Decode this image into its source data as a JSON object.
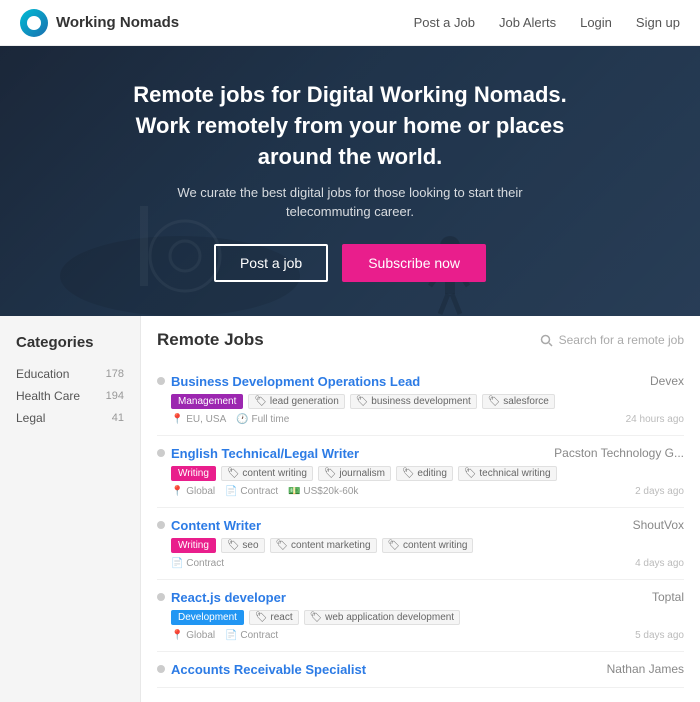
{
  "navbar": {
    "brand": "Working Nomads",
    "links": [
      "Post a Job",
      "Job Alerts",
      "Login",
      "Sign up"
    ]
  },
  "hero": {
    "title": "Remote jobs for Digital Working Nomads. Work remotely from your home or places around the world.",
    "subtitle": "We curate the best digital jobs for those looking to start their telecommuting career.",
    "button_post": "Post a job",
    "button_subscribe": "Subscribe now"
  },
  "sidebar": {
    "title": "Categories",
    "items": [
      {
        "label": "Education",
        "count": "178"
      },
      {
        "label": "Health Care",
        "count": "194"
      },
      {
        "label": "Legal",
        "count": "41"
      }
    ]
  },
  "jobs": {
    "section_title": "Remote Jobs",
    "search_placeholder": "Search for a remote job",
    "items": [
      {
        "title": "Business Development Operations Lead",
        "company": "Devex",
        "category": "Management",
        "category_class": "tag-management",
        "tags": [
          "lead generation",
          "business development",
          "salesforce"
        ],
        "meta_left": [
          "EU, USA",
          "Full time"
        ],
        "time": "24 hours ago"
      },
      {
        "title": "English Technical/Legal Writer",
        "company": "Pacston Technology G...",
        "category": "Writing",
        "category_class": "tag-writing",
        "tags": [
          "content writing",
          "journalism",
          "editing",
          "technical writing"
        ],
        "meta_left": [
          "Global",
          "Contract",
          "US$20k-60k"
        ],
        "time": "2 days ago"
      },
      {
        "title": "Content Writer",
        "company": "ShoutVox",
        "category": "Writing",
        "category_class": "tag-writing",
        "tags": [
          "seo",
          "content marketing",
          "content writing"
        ],
        "meta_left": [
          "Contract"
        ],
        "time": "4 days ago"
      },
      {
        "title": "React.js developer",
        "company": "Toptal",
        "category": "Development",
        "category_class": "tag-development",
        "tags": [
          "react",
          "web application development"
        ],
        "meta_left": [
          "Global",
          "Contract"
        ],
        "time": "5 days ago"
      },
      {
        "title": "Accounts Receivable Specialist",
        "company": "Nathan James",
        "category": "",
        "category_class": "",
        "tags": [],
        "meta_left": [],
        "time": ""
      }
    ]
  }
}
